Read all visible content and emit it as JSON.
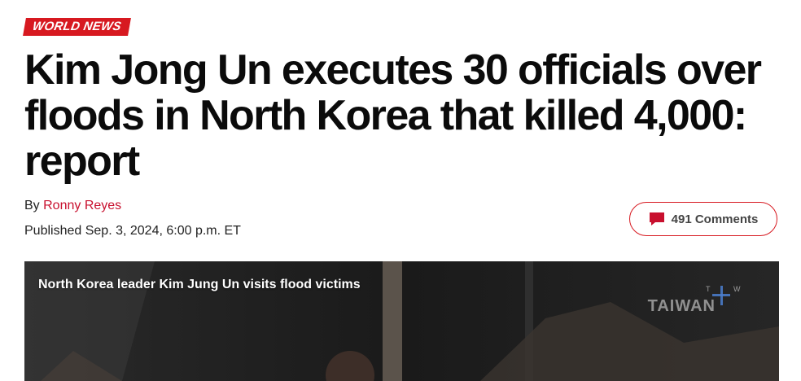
{
  "article": {
    "category": "WORLD NEWS",
    "headline": "Kim Jong Un executes 30 officials over floods in North Korea that killed 4,000: report",
    "byline_prefix": "By",
    "author": "Ronny Reyes",
    "published": "Published Sep. 3, 2024, 6:00 p.m. ET",
    "comments_label": "491 Comments"
  },
  "video": {
    "title": "North Korea leader Kim Jung Un visits flood victims",
    "watermark": "TAIWAN"
  },
  "colors": {
    "accent": "#d71920",
    "author_link": "#c8102e",
    "video_bg": "#141414"
  },
  "icons": {
    "comments": "speech-bubble-icon"
  }
}
